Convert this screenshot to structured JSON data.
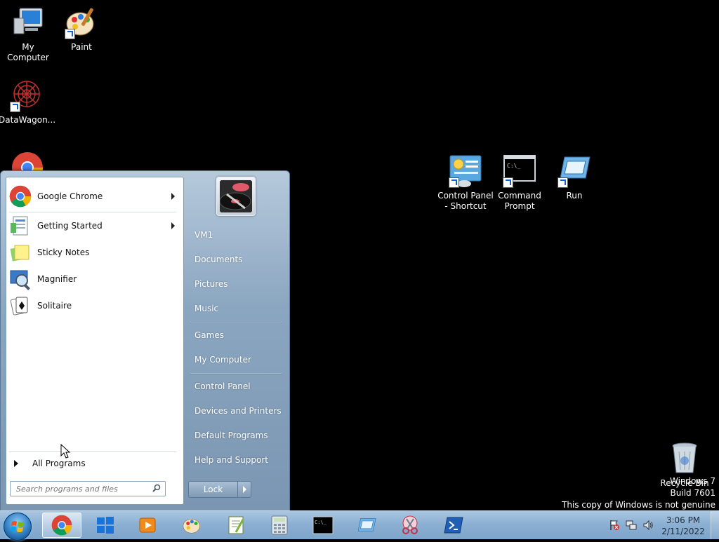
{
  "desktop": {
    "icons": [
      {
        "label": "My Computer",
        "icon": "computer-icon"
      },
      {
        "label": "Paint",
        "icon": "paint-palette-icon"
      },
      {
        "label": "DataWagon...",
        "icon": "datawagon-icon"
      },
      {
        "label": "Control Panel - Shortcut",
        "line1": "Control Panel",
        "line2": "- Shortcut",
        "icon": "control-panel-icon"
      },
      {
        "label": "Command Prompt",
        "line1": "Command",
        "line2": "Prompt",
        "icon": "command-prompt-icon"
      },
      {
        "label": "Run",
        "icon": "run-icon"
      },
      {
        "label": "Recycle Bin",
        "icon": "recycle-bin-icon"
      }
    ]
  },
  "start_menu": {
    "pinned": [
      {
        "label": "Google Chrome",
        "icon": "chrome-icon",
        "has_submenu": true
      }
    ],
    "recent": [
      {
        "label": "Getting Started",
        "icon": "getting-started-icon",
        "has_submenu": true
      },
      {
        "label": "Sticky Notes",
        "icon": "sticky-notes-icon",
        "has_submenu": false
      },
      {
        "label": "Magnifier",
        "icon": "magnifier-icon",
        "has_submenu": false
      },
      {
        "label": "Solitaire",
        "icon": "solitaire-icon",
        "has_submenu": false
      }
    ],
    "all_programs": "All Programs",
    "search_placeholder": "Search programs and files",
    "right_items": [
      {
        "label": "VM1"
      },
      {
        "label": "Documents"
      },
      {
        "label": "Pictures"
      },
      {
        "label": "Music"
      },
      {
        "label": "Games"
      },
      {
        "label": "My Computer"
      },
      {
        "label": "Control Panel"
      },
      {
        "label": "Devices and Printers"
      },
      {
        "label": "Default Programs"
      },
      {
        "label": "Help and Support"
      }
    ],
    "lock_label": "Lock"
  },
  "watermark": {
    "line1": "Windows 7",
    "line2": "Build 7601",
    "line3": "This copy of Windows is not genuine"
  },
  "taskbar": {
    "items": [
      {
        "name": "chrome-icon",
        "active": true
      },
      {
        "name": "windows-store-icon"
      },
      {
        "name": "media-player-icon"
      },
      {
        "name": "paint-palette-icon"
      },
      {
        "name": "notepad-plus-plus-icon"
      },
      {
        "name": "calculator-icon"
      },
      {
        "name": "command-prompt-icon"
      },
      {
        "name": "run-icon"
      },
      {
        "name": "snipping-tool-icon"
      },
      {
        "name": "powershell-icon"
      }
    ],
    "tray": [
      "action-center-icon",
      "network-icon",
      "volume-icon"
    ],
    "clock_time": "3:06 PM",
    "clock_date": "2/11/2022"
  },
  "colors": {
    "desktop_bg": "#000000",
    "taskbar": "#8cb0d3",
    "start_menu": "#8ba6c0"
  }
}
